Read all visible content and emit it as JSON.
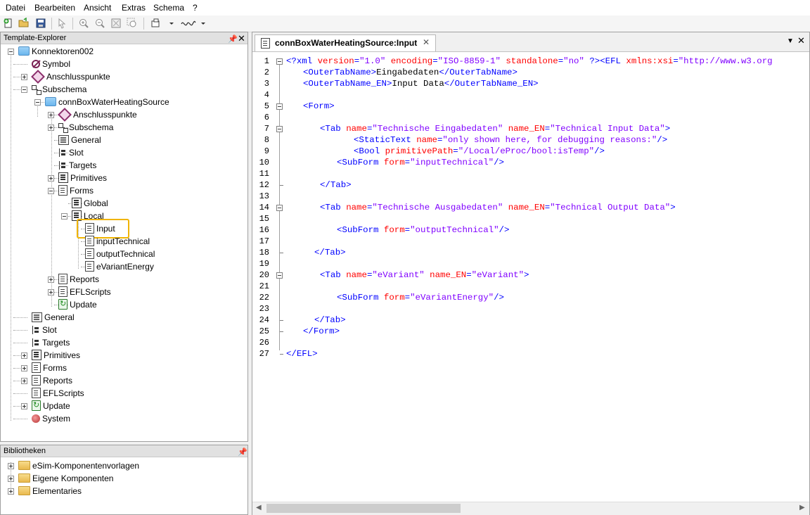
{
  "menu": [
    "Datei",
    "Bearbeiten",
    "Ansicht",
    "Extras",
    "Schema",
    "?"
  ],
  "explorer": {
    "title": "Template-Explorer",
    "root": "Konnektoren002",
    "items": {
      "symbol": "Symbol",
      "anschlusspunkte": "Anschlusspunkte",
      "subschema": "Subschema",
      "conn": "connBoxWaterHeatingSource",
      "sub_anschlusspunkte": "Anschlusspunkte",
      "sub_subschema": "Subschema",
      "sub_general": "General",
      "sub_slot": "Slot",
      "sub_targets": "Targets",
      "sub_primitives": "Primitives",
      "sub_forms": "Forms",
      "global": "Global",
      "local": "Local",
      "input": "Input",
      "input_technical": "inputTechnical",
      "output_technical": "outputTechnical",
      "evariant_energy": "eVariantEnergy",
      "sub_reports": "Reports",
      "sub_eflscripts": "EFLScripts",
      "sub_update": "Update",
      "general": "General",
      "slot": "Slot",
      "targets": "Targets",
      "primitives": "Primitives",
      "forms": "Forms",
      "reports": "Reports",
      "eflscripts": "EFLScripts",
      "update": "Update",
      "system": "System"
    }
  },
  "bibliotheken": {
    "title": "Bibliotheken",
    "items": [
      "eSim-Komponentenvorlagen",
      "Eigene Komponenten",
      "Elementaries"
    ]
  },
  "editor": {
    "tab_title": "connBoxWaterHeatingSource:Input",
    "lines": [
      "1",
      "2",
      "3",
      "4",
      "5",
      "6",
      "7",
      "8",
      "9",
      "10",
      "11",
      "12",
      "13",
      "14",
      "15",
      "16",
      "17",
      "18",
      "19",
      "20",
      "21",
      "22",
      "23",
      "24",
      "25",
      "26",
      "27"
    ],
    "code": {
      "l1a": "<?xml ",
      "l1b": "version",
      "l1c": "=",
      "l1d": "\"1.0\"",
      "l1e": " encoding",
      "l1f": "=",
      "l1g": "\"ISO-8859-1\"",
      "l1h": " standalone",
      "l1i": "=",
      "l1j": "\"no\"",
      "l1k": " ?><EFL ",
      "l1l": "xmlns:xsi",
      "l1m": "=",
      "l1n": "\"http://www.w3.org",
      "l2a": "<OuterTabName>",
      "l2b": "Eingabedaten",
      "l2c": "</OuterTabName>",
      "l3a": "<OuterTabName_EN>",
      "l3b": "Input Data",
      "l3c": "</OuterTabName_EN>",
      "l5": "<Form>",
      "l7a": "<Tab ",
      "l7b": "name",
      "l7c": "=",
      "l7d": "\"Technische Eingabedaten\"",
      "l7e": " name_EN",
      "l7f": "=",
      "l7g": "\"Technical Input Data\"",
      "l7h": ">",
      "l8a": "<StaticText ",
      "l8b": "name",
      "l8c": "=",
      "l8d": "\"only shown here, for debugging reasons:\"",
      "l8e": "/>",
      "l9a": "<Bool ",
      "l9b": "primitivePath",
      "l9c": "=",
      "l9d": "\"/Local/eProc/bool:isTemp\"",
      "l9e": "/>",
      "l10a": "<SubForm ",
      "l10b": "form",
      "l10c": "=",
      "l10d": "\"inputTechnical\"",
      "l10e": "/>",
      "l12": "</Tab>",
      "l14a": "<Tab ",
      "l14b": "name",
      "l14c": "=",
      "l14d": "\"Technische Ausgabedaten\"",
      "l14e": " name_EN",
      "l14f": "=",
      "l14g": "\"Technical Output Data\"",
      "l14h": ">",
      "l16a": "<SubForm ",
      "l16b": "form",
      "l16c": "=",
      "l16d": "\"outputTechnical\"",
      "l16e": "/>",
      "l18": "</Tab>",
      "l20a": "<Tab ",
      "l20b": "name",
      "l20c": "=",
      "l20d": "\"eVariant\"",
      "l20e": " name_EN",
      "l20f": "=",
      "l20g": "\"eVariant\"",
      "l20h": ">",
      "l22a": "<SubForm ",
      "l22b": "form",
      "l22c": "=",
      "l22d": "\"eVariantEnergy\"",
      "l22e": "/>",
      "l24": "</Tab>",
      "l25": "</Form>",
      "l27": "</EFL>"
    }
  },
  "colors": {
    "highlight": "#f0b400",
    "tag": "#0000ff",
    "attr": "#ff0000",
    "value": "#8000ff"
  }
}
